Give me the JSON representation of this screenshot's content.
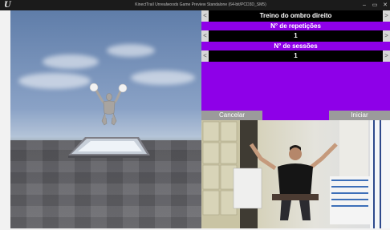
{
  "window": {
    "logo": "U",
    "title": "KinectTrail Unrealwoods Game Preview Standalone (64-bit/PCD3D_SM5)",
    "minimize": "–",
    "maximize": "▭",
    "close": "✕"
  },
  "exercise": {
    "title": "Treino do ombro direito",
    "reps_label": "N° de repetições",
    "reps_value": "1",
    "sessions_label": "N° de sessões",
    "sessions_value": "1",
    "arrow_left": "<",
    "arrow_right": ">"
  },
  "buttons": {
    "cancel": "Cancelar",
    "start": "Iniciar"
  },
  "colors": {
    "panel_purple": "#8e00e8",
    "bar_black": "#000000",
    "button_gray": "#9b9b9b"
  }
}
